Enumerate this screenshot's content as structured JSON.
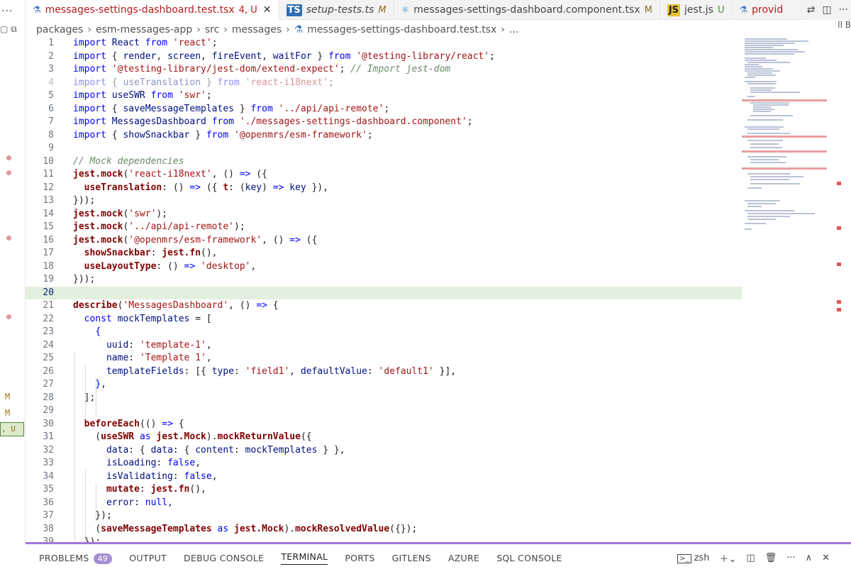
{
  "left_strip": {
    "ellipsis": "...",
    "markers": [
      "M",
      "M"
    ],
    "selected_label": ", U"
  },
  "tabs": [
    {
      "label": "messages-settings-dashboard.test.tsx",
      "status": "4, U",
      "icon": "flask-icon",
      "active": true
    },
    {
      "label": "setup-tests.ts",
      "status": "M",
      "icon": "ts-icon",
      "active": false
    },
    {
      "label": "messages-settings-dashboard.component.tsx",
      "status": "M",
      "icon": "react-icon",
      "active": false
    },
    {
      "label": "jest.js",
      "status": "U",
      "icon": "js-icon",
      "active": false
    },
    {
      "label": "provid",
      "status": "",
      "icon": "flask-icon",
      "active": false
    }
  ],
  "tab_actions": [
    "split-editor-icon",
    "more-actions-icon"
  ],
  "right_edge_text": "ll B",
  "breadcrumb": [
    "packages",
    "esm-messages-app",
    "src",
    "messages",
    "messages-settings-dashboard.test.tsx",
    "..."
  ],
  "editor": {
    "current_line": 20,
    "line_numbers": [
      1,
      2,
      3,
      4,
      5,
      6,
      7,
      8,
      9,
      10,
      11,
      12,
      13,
      14,
      15,
      16,
      17,
      18,
      19,
      20,
      21,
      22,
      23,
      24,
      25,
      26,
      27,
      28,
      29,
      30,
      31,
      32,
      33,
      34,
      35,
      36,
      37,
      38,
      39
    ]
  },
  "panel": {
    "tabs": [
      "PROBLEMS",
      "OUTPUT",
      "DEBUG CONSOLE",
      "TERMINAL",
      "PORTS",
      "GITLENS",
      "AZURE",
      "SQL CONSOLE"
    ],
    "problems_count": "49",
    "active_tab": "TERMINAL",
    "terminal_name": "zsh"
  },
  "colors": {
    "accent": "#a076d9",
    "current_line": "#e2f1de",
    "error": "#b71c1c"
  }
}
